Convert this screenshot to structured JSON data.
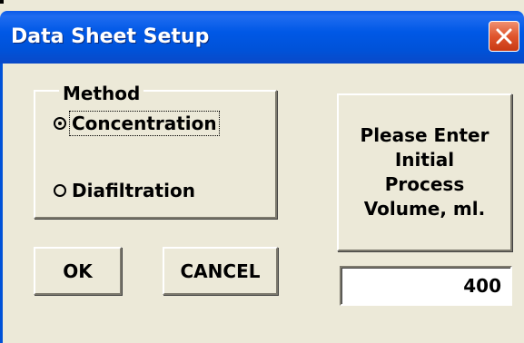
{
  "window": {
    "title": "Data Sheet Setup",
    "close_icon": "close-icon"
  },
  "method": {
    "legend": "Method",
    "options": [
      {
        "label": "Concentration",
        "selected": true
      },
      {
        "label": "Diafiltration",
        "selected": false
      }
    ]
  },
  "prompt": {
    "line1": "Please Enter",
    "line2": "Initial",
    "line3": "Process",
    "line4": "Volume, ml."
  },
  "volume_input": {
    "value": "400"
  },
  "buttons": {
    "ok_label": "OK",
    "cancel_label": "CANCEL"
  },
  "colors": {
    "titlebar": "#0052d8",
    "dialog_bg": "#ece9d8",
    "close_button": "#e0552d"
  }
}
